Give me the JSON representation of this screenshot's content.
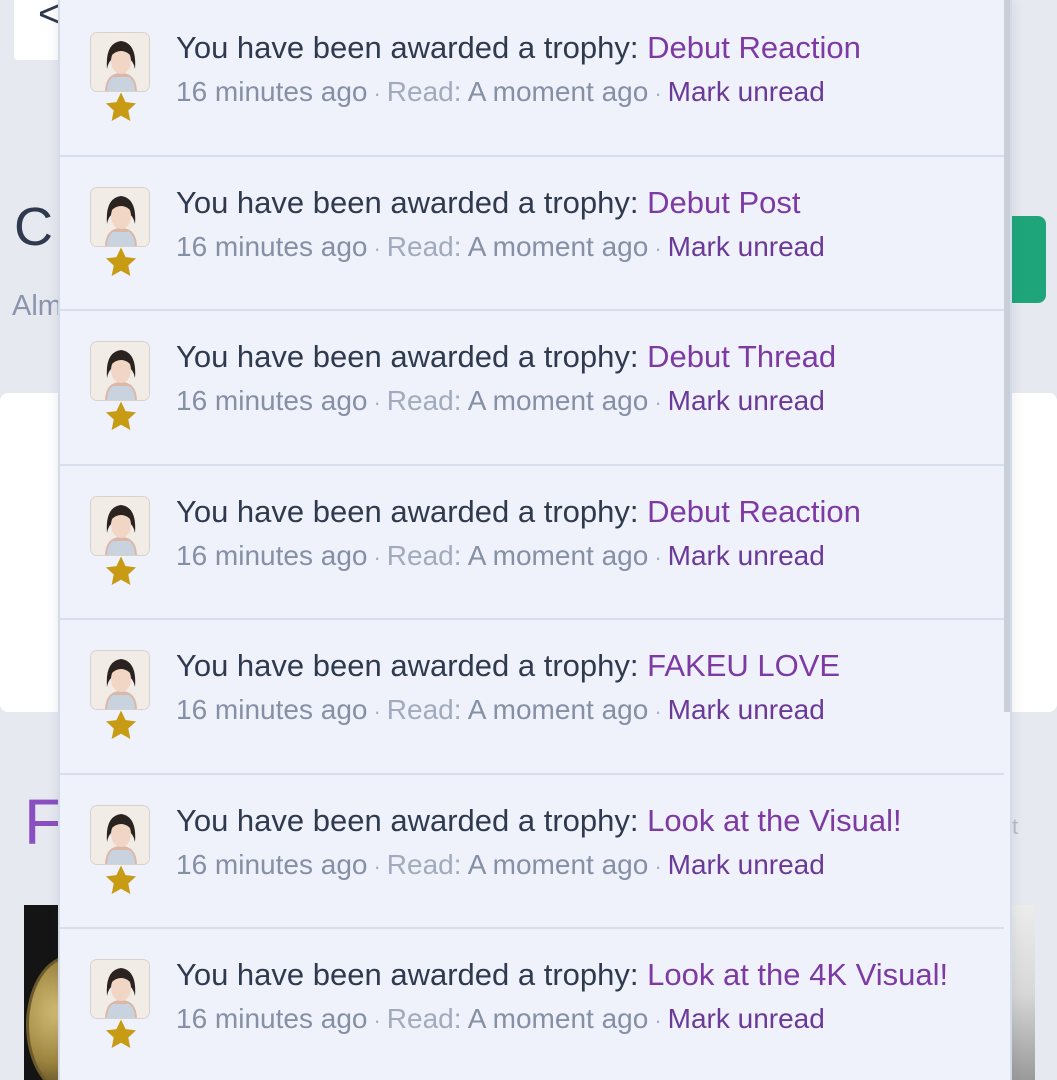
{
  "background": {
    "heading_initial": "C",
    "sub_text": "Alm",
    "section_initial": "F",
    "faint_text": "t",
    "back_glyph": "<"
  },
  "notifications": [
    {
      "prefix": "You have been awarded a trophy:",
      "trophy": "Debut Reaction",
      "time": "16 minutes ago",
      "read_label": "Read:",
      "read_time": "A moment ago",
      "action": "Mark unread"
    },
    {
      "prefix": "You have been awarded a trophy:",
      "trophy": "Debut Post",
      "time": "16 minutes ago",
      "read_label": "Read:",
      "read_time": "A moment ago",
      "action": "Mark unread"
    },
    {
      "prefix": "You have been awarded a trophy:",
      "trophy": "Debut Thread",
      "time": "16 minutes ago",
      "read_label": "Read:",
      "read_time": "A moment ago",
      "action": "Mark unread"
    },
    {
      "prefix": "You have been awarded a trophy:",
      "trophy": "Debut Reaction",
      "time": "16 minutes ago",
      "read_label": "Read:",
      "read_time": "A moment ago",
      "action": "Mark unread"
    },
    {
      "prefix": "You have been awarded a trophy:",
      "trophy": "FAKEU LOVE",
      "time": "16 minutes ago",
      "read_label": "Read:",
      "read_time": "A moment ago",
      "action": "Mark unread"
    },
    {
      "prefix": "You have been awarded a trophy:",
      "trophy": "Look at the Visual!",
      "time": "16 minutes ago",
      "read_label": "Read:",
      "read_time": "A moment ago",
      "action": "Mark unread"
    },
    {
      "prefix": "You have been awarded a trophy:",
      "trophy": "Look at the 4K Visual!",
      "time": "16 minutes ago",
      "read_label": "Read:",
      "read_time": "A moment ago",
      "action": "Mark unread"
    }
  ],
  "separator": "·",
  "icons": {
    "avatar": "user-avatar",
    "badge": "trophy-star-icon"
  },
  "colors": {
    "trophy_link": "#7d3aa3",
    "mark_unread": "#6b3a98",
    "star": "#c89b14",
    "text": "#2f3a4f"
  }
}
